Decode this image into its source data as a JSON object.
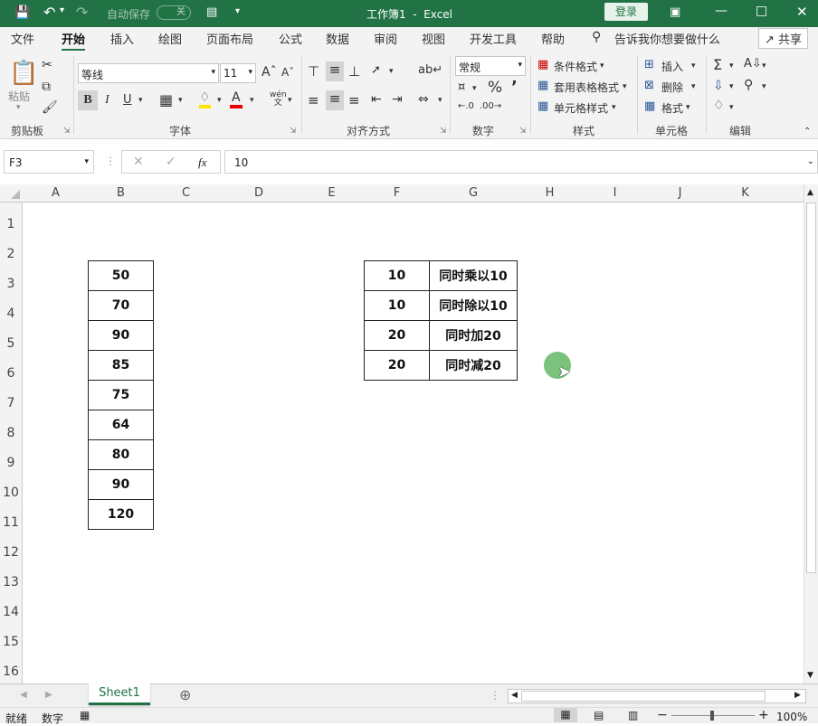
{
  "titlebar": {
    "autosave_label": "自动保存",
    "autosave_state": "关",
    "doc_title": "工作簿1  -  Excel",
    "login_label": "登录"
  },
  "menu": {
    "items": [
      "文件",
      "开始",
      "插入",
      "绘图",
      "页面布局",
      "公式",
      "数据",
      "审阅",
      "视图",
      "开发工具",
      "帮助"
    ],
    "active": "开始",
    "tell_me": "告诉我你想要做什么",
    "share": "共享"
  },
  "ribbon": {
    "clipboard": {
      "group": "剪贴板",
      "paste": "粘贴"
    },
    "font": {
      "group": "字体",
      "font_name": "等线",
      "font_size": "11",
      "bold": "B",
      "italic": "I",
      "underline": "U"
    },
    "alignment": {
      "group": "对齐方式"
    },
    "number": {
      "group": "数字",
      "format": "常规"
    },
    "styles": {
      "group": "样式",
      "conditional": "条件格式",
      "table": "套用表格格式",
      "cell_styles": "单元格样式"
    },
    "cells": {
      "group": "单元格",
      "insert": "插入",
      "delete": "删除",
      "format": "格式"
    },
    "editing": {
      "group": "编辑"
    }
  },
  "formula_bar": {
    "name_box": "F3",
    "value": "10"
  },
  "columns": [
    "A",
    "B",
    "C",
    "D",
    "E",
    "F",
    "G",
    "H",
    "I",
    "J",
    "K"
  ],
  "rows": [
    "1",
    "2",
    "3",
    "4",
    "5",
    "6",
    "7",
    "8",
    "9",
    "10",
    "11",
    "12",
    "13",
    "14",
    "15",
    "16"
  ],
  "table_b": [
    "50",
    "70",
    "90",
    "85",
    "75",
    "64",
    "80",
    "90",
    "120"
  ],
  "table_fg": [
    {
      "value": "10",
      "op": "同时乘以10"
    },
    {
      "value": "10",
      "op": "同时除以10"
    },
    {
      "value": "20",
      "op": "同时加20"
    },
    {
      "value": "20",
      "op": "同时减20"
    }
  ],
  "sheets": {
    "active": "Sheet1"
  },
  "status": {
    "ready": "就绪",
    "mode": "数字",
    "zoom": "100%"
  },
  "colors": {
    "accent": "#217346",
    "cursor_dot": "#4caf50"
  }
}
